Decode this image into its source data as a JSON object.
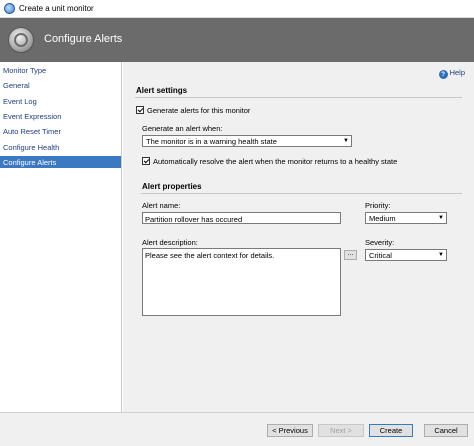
{
  "window": {
    "title": "Create a unit monitor"
  },
  "banner": {
    "heading": "Configure Alerts",
    "icon": "monitor-orb-icon"
  },
  "nav": {
    "items": [
      {
        "label": "Monitor Type"
      },
      {
        "label": "General"
      },
      {
        "label": "Event Log"
      },
      {
        "label": "Event Expression"
      },
      {
        "label": "Auto Reset Timer"
      },
      {
        "label": "Configure Health"
      },
      {
        "label": "Configure Alerts",
        "active": true
      }
    ]
  },
  "help": {
    "label": "Help"
  },
  "alert_settings": {
    "title": "Alert settings",
    "generate_alerts_label": "Generate alerts for this monitor",
    "generate_alerts_checked": true,
    "generate_when_label": "Generate an alert when:",
    "generate_when_value": "The monitor is in a warning health state",
    "auto_resolve_label": "Automatically resolve the alert when the monitor returns to a healthy state",
    "auto_resolve_checked": true
  },
  "alert_properties": {
    "title": "Alert properties",
    "name_label": "Alert name:",
    "name_value": "Partition rollover has occured",
    "priority_label": "Priority:",
    "priority_value": "Medium",
    "description_label": "Alert description:",
    "description_value": "Please see the alert context for details.",
    "ellipsis_label": "...",
    "severity_label": "Severity:",
    "severity_value": "Critical"
  },
  "footer": {
    "previous": "< Previous",
    "next": "Next >",
    "create": "Create",
    "cancel": "Cancel"
  },
  "colors": {
    "banner": "#6b6b6b",
    "nav_active": "#3c79c0",
    "content_bg": "#f0f0f0"
  }
}
